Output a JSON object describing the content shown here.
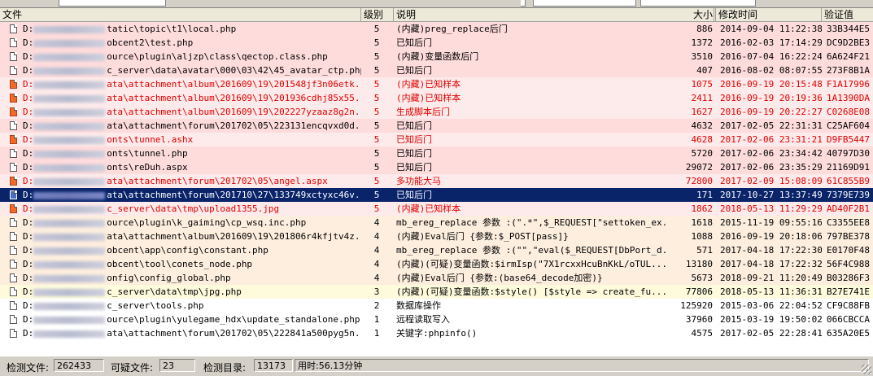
{
  "header": {
    "file": "文件",
    "level": "级别",
    "desc": "说明",
    "size": "大小",
    "time": "修改时间",
    "hash": "验证值"
  },
  "colors": {
    "pink": "#ffdcdc",
    "lightpink": "#fdeaea",
    "peach": "#fdeede",
    "yellow": "#fdfbdc",
    "white": "#ffffff",
    "selected": "#0a246a",
    "red_text": "#e00000"
  },
  "rows": [
    {
      "drive": "D:",
      "path": "tatic\\topic\\t1\\local.php",
      "level": "5",
      "desc": "(内藏)preg_replace后门",
      "size": "886",
      "time": "2014-09-04 11:22:38",
      "hash": "33B344E5",
      "bg": "#ffdcdc",
      "fg": "#000000",
      "icon": "white"
    },
    {
      "drive": "D:",
      "path": "obcent2\\test.php",
      "level": "5",
      "desc": "已知后门",
      "size": "1372",
      "time": "2016-02-03 17:14:29",
      "hash": "DC9D2BE3",
      "bg": "#ffdcdc",
      "fg": "#000000",
      "icon": "white"
    },
    {
      "drive": "D:",
      "path": "ource\\plugin\\aljzp\\class\\qectop.class.php",
      "level": "5",
      "desc": "(内藏)变量函数后门",
      "size": "3510",
      "time": "2016-07-04 16:22:24",
      "hash": "6A624F21",
      "bg": "#ffdcdc",
      "fg": "#000000",
      "icon": "white"
    },
    {
      "drive": "D:",
      "path": "c_server\\data\\avatar\\000\\03\\42\\45_avatar_ctp.php",
      "level": "5",
      "desc": "已知后门",
      "size": "407",
      "time": "2016-08-02 08:07:55",
      "hash": "273F8B1A",
      "bg": "#ffdcdc",
      "fg": "#000000",
      "icon": "white"
    },
    {
      "drive": "D:",
      "path": "ata\\attachment\\album\\201609\\19\\201548jf3n06etk...",
      "level": "5",
      "desc": "(内藏)已知样本",
      "size": "1075",
      "time": "2016-09-19 20:15:48",
      "hash": "F1A17996",
      "bg": "#fdeaea",
      "fg": "#e00000",
      "icon": "orange"
    },
    {
      "drive": "D:",
      "path": "ata\\attachment\\album\\201609\\19\\201936cdhj85x55...",
      "level": "5",
      "desc": "(内藏)已知样本",
      "size": "2411",
      "time": "2016-09-19 20:19:36",
      "hash": "1A1390DA",
      "bg": "#fdeaea",
      "fg": "#e00000",
      "icon": "orange"
    },
    {
      "drive": "D:",
      "path": "ata\\attachment\\album\\201609\\19\\202227yzaaz8g2n...",
      "level": "5",
      "desc": "生成脚本后门",
      "size": "1627",
      "time": "2016-09-19 20:22:27",
      "hash": "C0268E08",
      "bg": "#fdeaea",
      "fg": "#e00000",
      "icon": "orange"
    },
    {
      "drive": "D:",
      "path": "ata\\attachment\\forum\\201702\\05\\223131encqvxd0d...",
      "level": "5",
      "desc": "已知后门",
      "size": "4632",
      "time": "2017-02-05 22:31:31",
      "hash": "C25AF604",
      "bg": "#ffdcdc",
      "fg": "#000000",
      "icon": "white"
    },
    {
      "drive": "D:",
      "path": "onts\\tunnel.ashx",
      "level": "5",
      "desc": "已知后门",
      "size": "4628",
      "time": "2017-02-06 23:31:21",
      "hash": "D9FB5447",
      "bg": "#fdeaea",
      "fg": "#e00000",
      "icon": "orange"
    },
    {
      "drive": "D:",
      "path": "onts\\tunnel.php",
      "level": "5",
      "desc": "已知后门",
      "size": "5720",
      "time": "2017-02-06 23:34:42",
      "hash": "40797D30",
      "bg": "#ffdcdc",
      "fg": "#000000",
      "icon": "white"
    },
    {
      "drive": "D:",
      "path": "onts\\reDuh.aspx",
      "level": "5",
      "desc": "已知后门",
      "size": "29072",
      "time": "2017-02-06 23:35:29",
      "hash": "21169D91",
      "bg": "#ffdcdc",
      "fg": "#000000",
      "icon": "white"
    },
    {
      "drive": "D:",
      "path": "ata\\attachment\\forum\\201702\\05\\angel.aspx",
      "level": "5",
      "desc": "多功能大马",
      "size": "72800",
      "time": "2017-02-09 15:08:09",
      "hash": "61C855B9",
      "bg": "#fdeaea",
      "fg": "#e00000",
      "icon": "orange"
    },
    {
      "drive": "D:",
      "path": "ata\\attachment\\forum\\201710\\27\\133749xctyxc46v...",
      "level": "5",
      "desc": "已知后门",
      "size": "171",
      "time": "2017-10-27 13:37:49",
      "hash": "7379E739",
      "bg": "#0a246a",
      "fg": "#ffffff",
      "icon": "blue",
      "selected": true
    },
    {
      "drive": "D:",
      "path": "c_server\\data\\tmp\\upload1355.jpg",
      "level": "5",
      "desc": "(内藏)已知样本",
      "size": "1862",
      "time": "2018-05-13 11:29:29",
      "hash": "AD40F2B1",
      "bg": "#fdeaea",
      "fg": "#e00000",
      "icon": "orange"
    },
    {
      "drive": "D:",
      "path": "ource\\plugin\\k_gaiming\\cp_wsq.inc.php",
      "level": "4",
      "desc": "mb_ereg_replace 参数 :(\".*\",$_REQUEST[\"settoken_ex...",
      "size": "1618",
      "time": "2015-11-19 09:55:16",
      "hash": "C3355EE8",
      "bg": "#fdeede",
      "fg": "#000000",
      "icon": "white"
    },
    {
      "drive": "D:",
      "path": "ata\\attachment\\album\\201609\\19\\201806r4kfjtv4z...",
      "level": "4",
      "desc": "(内藏)Eval后门 {参数:$_POST[pass]}",
      "size": "1088",
      "time": "2016-09-19 20:18:06",
      "hash": "797BE378",
      "bg": "#fdeede",
      "fg": "#000000",
      "icon": "white"
    },
    {
      "drive": "D:",
      "path": "obcent\\app\\config\\constant.php",
      "level": "4",
      "desc": "mb_ereg_replace 参数 :(\"\",\"eval($_REQUEST[DbPort_d...",
      "size": "571",
      "time": "2017-04-18 17:22:30",
      "hash": "E0170F48",
      "bg": "#fdeede",
      "fg": "#000000",
      "icon": "white"
    },
    {
      "drive": "D:",
      "path": "obcent\\tool\\conets_node.php",
      "level": "4",
      "desc": "(内藏)(可疑)变量函数:$irmIsp(\"7X1rcxxHcuBnKkL/oTUL...",
      "size": "13180",
      "time": "2017-04-18 17:22:32",
      "hash": "56F4C988",
      "bg": "#fdeede",
      "fg": "#000000",
      "icon": "white"
    },
    {
      "drive": "D:",
      "path": "onfig\\config_global.php",
      "level": "4",
      "desc": "(内藏)Eval后门 {参数:(base64_decode加密)}",
      "size": "5673",
      "time": "2018-09-21 11:20:49",
      "hash": "B03286F3",
      "bg": "#fdeede",
      "fg": "#000000",
      "icon": "white"
    },
    {
      "drive": "D:",
      "path": "c_server\\data\\tmp\\jpg.php",
      "level": "3",
      "desc": "(内藏)(可疑)变量函数:$style() [$style => create_fu...",
      "size": "77806",
      "time": "2018-05-13 11:36:31",
      "hash": "B27E741E",
      "bg": "#fdfbdc",
      "fg": "#000000",
      "icon": "white"
    },
    {
      "drive": "D:",
      "path": "c_server\\tools.php",
      "level": "2",
      "desc": "数据库操作",
      "size": "125920",
      "time": "2015-03-06 22:04:52",
      "hash": "CF9C88FB",
      "bg": "#ffffff",
      "fg": "#000000",
      "icon": "white"
    },
    {
      "drive": "D:",
      "path": "ource\\plugin\\yulegame_hdx\\update_standalone.php",
      "level": "1",
      "desc": "远程读取写入",
      "size": "37960",
      "time": "2015-03-19 19:50:02",
      "hash": "066CBCCA",
      "bg": "#ffffff",
      "fg": "#000000",
      "icon": "white"
    },
    {
      "drive": "D:",
      "path": "ata\\attachment\\forum\\201702\\05\\222841a500pyg5n...",
      "level": "1",
      "desc": "关键字:phpinfo()",
      "size": "4575",
      "time": "2017-02-05 22:28:41",
      "hash": "635A20E5",
      "bg": "#ffffff",
      "fg": "#000000",
      "icon": "white"
    }
  ],
  "status": {
    "checked_label": "检测文件:",
    "checked_value": "262433",
    "suspicious_label": "可疑文件:",
    "suspicious_value": "23",
    "dirs_label": "检测目录:",
    "dirs_value": "13173",
    "elapsed": "用时:56.13分钟"
  }
}
